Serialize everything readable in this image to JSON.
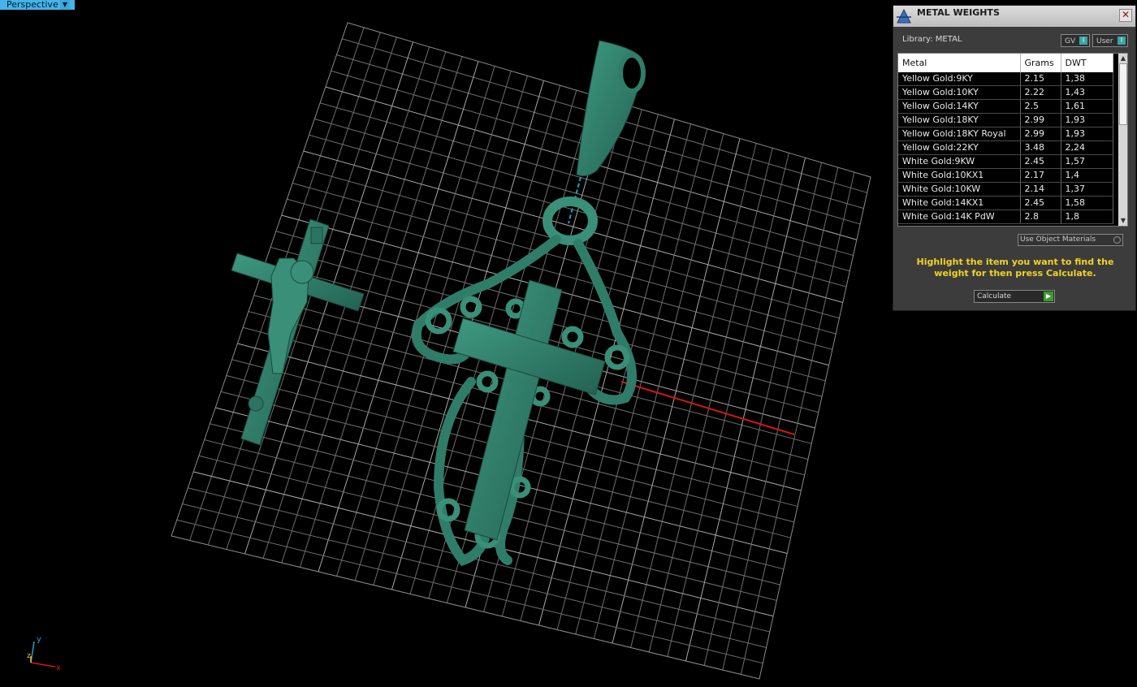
{
  "viewport": {
    "label": "Perspective",
    "dropdown_glyph": "▼"
  },
  "axis": {
    "x": "x",
    "y": "y",
    "z": "z"
  },
  "panel": {
    "title": "METAL WEIGHTS",
    "close_glyph": "✕",
    "library_label": "Library: METAL",
    "toggle_gv": "GV",
    "toggle_user": "User",
    "toggle_glyph": "I",
    "table": {
      "headers": [
        "Metal",
        "Grams",
        "DWT"
      ],
      "rows": [
        [
          "Yellow Gold:9KY",
          "2.15",
          "1,38"
        ],
        [
          "Yellow Gold:10KY",
          "2.22",
          "1,43"
        ],
        [
          "Yellow Gold:14KY",
          "2.5",
          "1,61"
        ],
        [
          "Yellow Gold:18KY",
          "2.99",
          "1,93"
        ],
        [
          "Yellow Gold:18KY Royal",
          "2.99",
          "1,93"
        ],
        [
          "Yellow Gold:22KY",
          "3.48",
          "2,24"
        ],
        [
          "White Gold:9KW",
          "2.45",
          "1,57"
        ],
        [
          "White Gold:10KX1",
          "2.17",
          "1,4"
        ],
        [
          "White Gold:10KW",
          "2.14",
          "1,37"
        ],
        [
          "White Gold:14KX1",
          "2.45",
          "1,58"
        ],
        [
          "White Gold:14K PdW",
          "2.8",
          "1,8"
        ]
      ],
      "scroll_up": "▲",
      "scroll_down": "▼"
    },
    "use_object_materials": "Use Object Materials",
    "hint": "Highlight the item you want to find the weight for then press Calculate.",
    "calculate_label": "Calculate",
    "calculate_glyph": "▶"
  },
  "colors": {
    "model": "#2f7d69",
    "grid": "#9a9a9a",
    "x_axis": "#d01818",
    "hint": "#f2d322",
    "accent": "#45b4e8"
  }
}
